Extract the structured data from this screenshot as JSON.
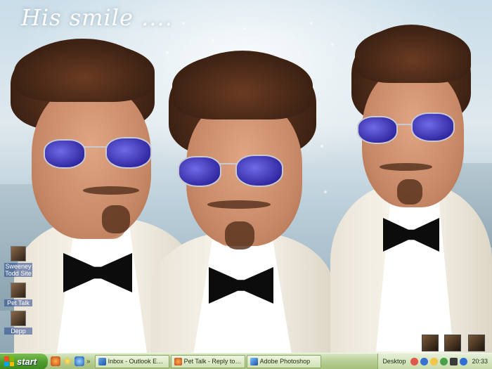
{
  "wallpaper": {
    "title": "His smile ...."
  },
  "desktop_icons": [
    {
      "label": "Sweeney Todd Site",
      "icon": "shortcut-icon"
    },
    {
      "label": "Pet Talk",
      "icon": "shortcut-icon"
    },
    {
      "label": "Depp",
      "icon": "shortcut-icon"
    }
  ],
  "taskbar": {
    "start_label": "start",
    "quick_launch": [
      "firefox-icon",
      "favorites-star-icon",
      "ie-icon"
    ],
    "more_chevron": "»",
    "tasks": [
      {
        "label": "Inbox - Outlook Express",
        "icon": "outlook-icon"
      },
      {
        "label": "Pet Talk - Reply to To...",
        "icon": "firefox-icon"
      },
      {
        "label": "Adobe Photoshop",
        "icon": "photoshop-icon"
      }
    ],
    "desktop_label": "Desktop",
    "clock": "20:33"
  },
  "colors": {
    "taskbar": "#b9d098",
    "start": "#4a9a2c",
    "lens": "#2b229a"
  }
}
